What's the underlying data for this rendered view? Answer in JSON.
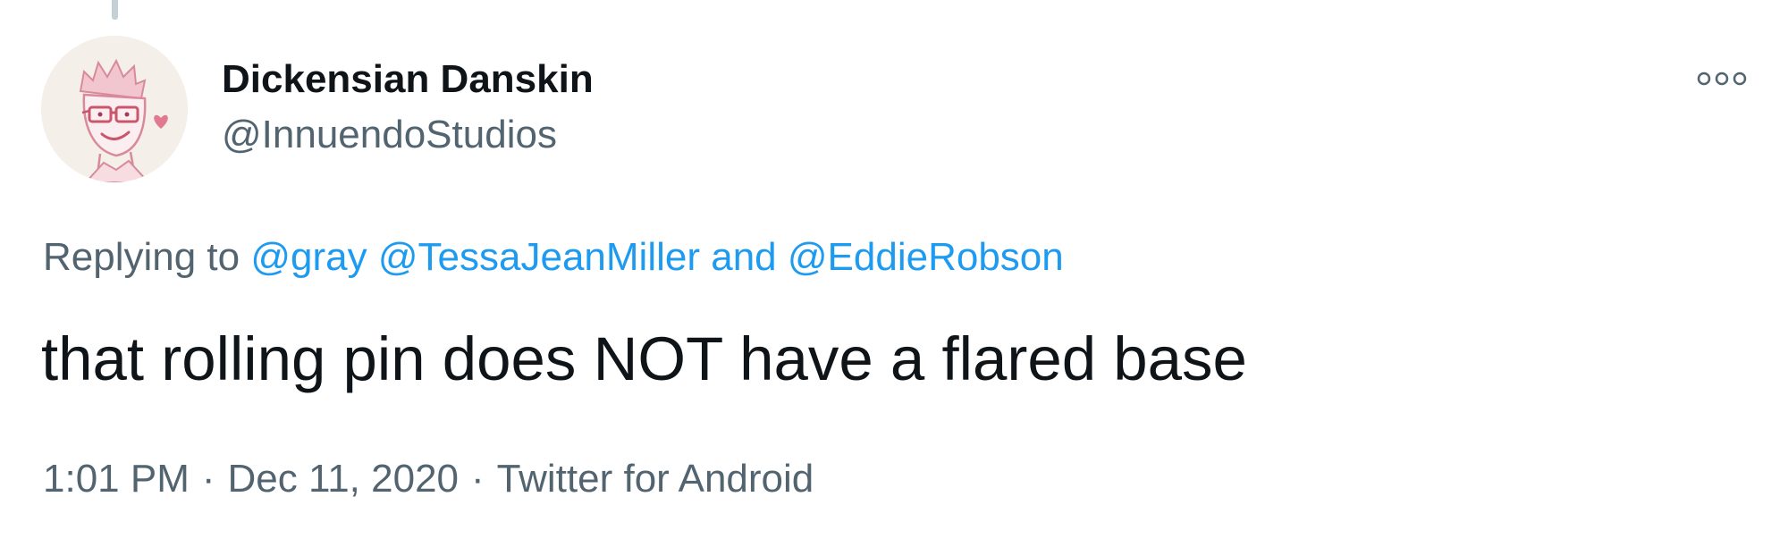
{
  "tweet": {
    "author": {
      "display_name": "Dickensian Danskin",
      "handle": "@InnuendoStudios",
      "avatar_icon": "cartoon-avatar-icon"
    },
    "more_icon": "more-options-icon",
    "reply": {
      "prefix": "Replying to",
      "mentions": [
        "@gray",
        "@TessaJeanMiller"
      ],
      "conjunction": "and",
      "last_mention": "@EddieRobson"
    },
    "text": "that rolling pin does NOT have a flared base",
    "meta": {
      "time": "1:01 PM",
      "separator": "·",
      "date": "Dec 11, 2020",
      "source": "Twitter for Android"
    }
  },
  "colors": {
    "text_primary": "#0f1419",
    "text_secondary": "#536471",
    "link": "#1d9bf0"
  }
}
